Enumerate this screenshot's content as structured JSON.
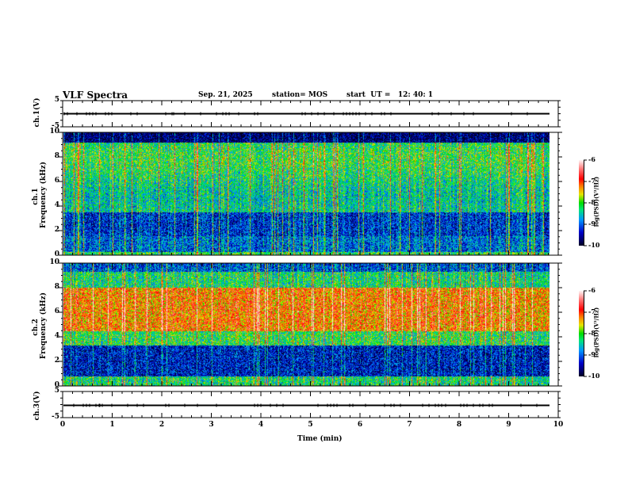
{
  "header": {
    "title": "VLF Spectra",
    "date": "Sep. 21, 2025",
    "station": "station= MOS",
    "start": "start  UT =   12: 40: 1"
  },
  "chart_data": [
    {
      "type": "line",
      "ylabel": "ch.1(V)",
      "ylim": [
        -5,
        5
      ],
      "yticks": [
        "5",
        "-5"
      ],
      "xlim": [
        0,
        10
      ],
      "values_note": "",
      "baseline": 0
    },
    {
      "type": "heatmap",
      "ylabel": "ch.1\nFrequency (kHz)",
      "ylabel_top": "ch.1",
      "ylabel_bottom": "Frequency (kHz)",
      "ylim": [
        0,
        10
      ],
      "yticks": [
        "0",
        "2",
        "4",
        "6",
        "8",
        "10"
      ],
      "xlim": [
        0,
        9.83
      ],
      "colorbar": {
        "label": "log(PSD)(V²/Hz)",
        "range": [
          -10,
          -6
        ],
        "ticks": [
          "-6",
          "-7",
          "-8",
          "-9",
          "-10"
        ]
      }
    },
    {
      "type": "heatmap",
      "ylabel_top": "ch.2",
      "ylabel_bottom": "Frequency (kHz)",
      "ylim": [
        0,
        10
      ],
      "yticks": [
        "0",
        "2",
        "4",
        "6",
        "8",
        "10"
      ],
      "xlim": [
        0,
        9.83
      ],
      "colorbar": {
        "label": "log(PSD)(V²/Hz)",
        "range": [
          -10,
          -6
        ],
        "ticks": [
          "-6",
          "-7",
          "-8",
          "-9",
          "-10"
        ]
      }
    },
    {
      "type": "line",
      "ylabel": "ch.3(V)",
      "ylim": [
        -5,
        5
      ],
      "yticks": [
        "5",
        "-5"
      ],
      "xlim": [
        0,
        10
      ],
      "baseline": 0
    }
  ],
  "xaxis": {
    "label": "Time (min)",
    "ticks": [
      "0",
      "1",
      "2",
      "3",
      "4",
      "5",
      "6",
      "7",
      "8",
      "9",
      "10"
    ]
  },
  "colors": {
    "frame": "#000000"
  }
}
